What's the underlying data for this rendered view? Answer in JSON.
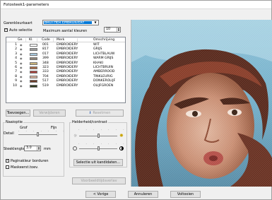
{
  "window": {
    "title": "Fotosteek1-parameters"
  },
  "palette": {
    "label": "Garenkleurkaart",
    "selected": "BROTHER EMBROIDERY",
    "auto_select_label": "Auto selectie",
    "auto_select_checked": true,
    "max_colors_label": "Maximum aantal kleuren",
    "max_colors_value": "10"
  },
  "table": {
    "headers": [
      "Ge.",
      "Kl.",
      "Code",
      "Merk",
      "Omschrijving"
    ],
    "rows": [
      {
        "num": "1",
        "color": "#ffffff",
        "code": "001",
        "brand": "EMBROIDERY",
        "desc": "WIT"
      },
      {
        "num": "2",
        "color": "#9a9a9a",
        "code": "817",
        "brand": "EMBROIDERY",
        "desc": "GRIJS"
      },
      {
        "num": "3",
        "color": "#a6c8de",
        "code": "017",
        "brand": "EMBROIDERY",
        "desc": "LICHTBLAUW"
      },
      {
        "num": "4",
        "color": "#8e8479",
        "code": "399",
        "brand": "EMBROIDERY",
        "desc": "WARM GRIJS"
      },
      {
        "num": "5",
        "color": "#c9b27a",
        "code": "348",
        "brand": "EMBROIDERY",
        "desc": "KHAKI"
      },
      {
        "num": "6",
        "color": "#a86a45",
        "code": "323",
        "brand": "EMBROIDERY",
        "desc": "LICHTBRUIN"
      },
      {
        "num": "7",
        "color": "#a93f3a",
        "code": "333",
        "brand": "EMBROIDERY",
        "desc": "AMBERROOD"
      },
      {
        "num": "8",
        "color": "#d6b09a",
        "code": "704",
        "brand": "EMBROIDERY",
        "desc": "TINKLEURIG"
      },
      {
        "num": "9",
        "color": "#6a3a26",
        "code": "517",
        "brand": "EMBROIDERY",
        "desc": "DONKEROLIJF"
      },
      {
        "num": "10",
        "color": "#2f3a1f",
        "code": "519",
        "brand": "EMBROIDERY",
        "desc": "OLIJFGROEN"
      }
    ]
  },
  "list_buttons": {
    "add": "Toevoegen...",
    "remove": "Verwijderen",
    "reset": "Resetmen"
  },
  "stitch": {
    "group_title": "Naaioptie",
    "coarse_label": "Grof",
    "fine_label": "Fijn",
    "detail_label": "Detail",
    "detail_level": 0.5,
    "stitch_length_label": "Steeklengte",
    "stitch_length_value": "3.0",
    "unit": "mm",
    "page_color_label": "Paginakleur borduren",
    "page_color_checked": true,
    "mask_label": "Maskeerst.toev.",
    "mask_checked": false
  },
  "brightness": {
    "group_title": "Helderheid/contrast",
    "brightness_level": 0.5,
    "contrast_level": 0.5,
    "candidates_button": "Selectie uit kandidaten..."
  },
  "preview_button": "Voorbeeldtijdsverlav",
  "footer": {
    "back": "< Vorige",
    "cancel": "Annuleren",
    "finish": "Voltooien"
  },
  "icons": {
    "combo_arrow": "chevron-down-icon",
    "eye": "eye-icon",
    "sun": "sun-icon",
    "contrast": "contrast-icon"
  }
}
